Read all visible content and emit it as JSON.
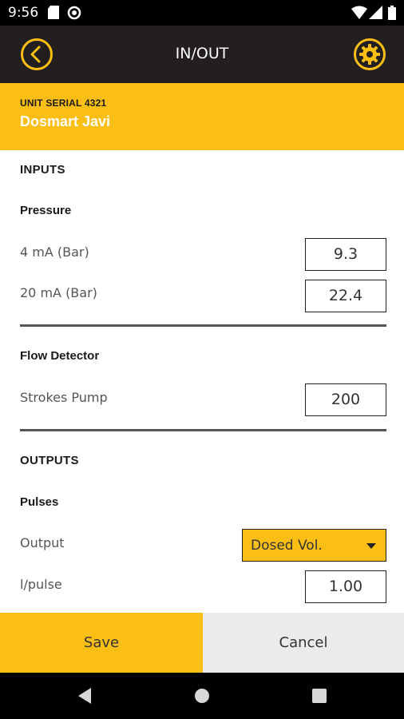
{
  "status_bar": {
    "time": "9:56",
    "icons": [
      "sd-card-icon",
      "sync-icon",
      "wifi-icon",
      "signal-icon",
      "battery-icon"
    ]
  },
  "app_bar": {
    "title": "IN/OUT",
    "back_icon": "chevron-left-circle-icon",
    "settings_icon": "gear-icon"
  },
  "unit": {
    "serial_label": "UNIT SERIAL 4321",
    "name": "Dosmart Javi"
  },
  "inputs": {
    "title": "INPUTS",
    "pressure": {
      "title": "Pressure",
      "rows": [
        {
          "label": "4 mA (Bar)",
          "value": "9.3"
        },
        {
          "label": "20 mA (Bar)",
          "value": "22.4"
        }
      ]
    },
    "flow_detector": {
      "title": "Flow Detector",
      "rows": [
        {
          "label": "Strokes Pump",
          "value": "200"
        }
      ]
    }
  },
  "outputs": {
    "title": "OUTPUTS",
    "pulses": {
      "title": "Pulses",
      "output_label": "Output",
      "output_selected": "Dosed Vol.",
      "lpulse_label": "l/pulse",
      "lpulse_value": "1.00"
    }
  },
  "actions": {
    "save_label": "Save",
    "cancel_label": "Cancel"
  },
  "colors": {
    "accent": "#fbbe15",
    "dark": "#231f20",
    "cancel_bg": "#ebebeb"
  }
}
